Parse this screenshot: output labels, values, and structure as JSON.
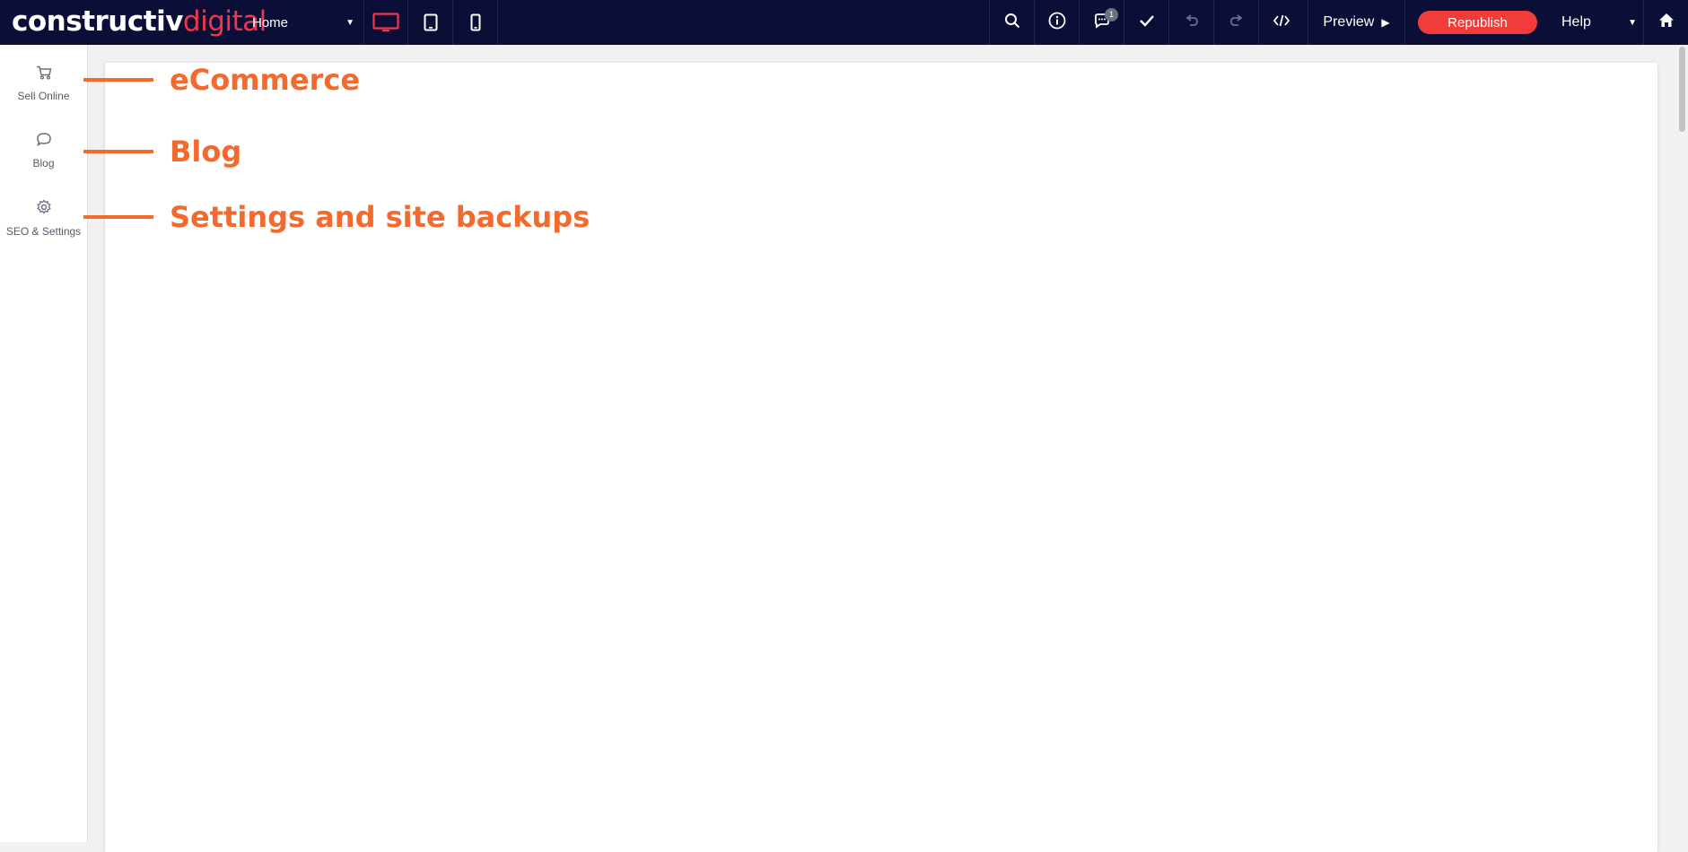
{
  "header": {
    "logo_part1": "constructiv",
    "logo_part2": "digital",
    "page_selector": "Home",
    "device_buttons": [
      {
        "name": "desktop",
        "icon": "desktop-icon",
        "active": true
      },
      {
        "name": "tablet",
        "icon": "tablet-icon",
        "active": false
      },
      {
        "name": "mobile",
        "icon": "mobile-icon",
        "active": false
      }
    ],
    "tools": [
      {
        "name": "search",
        "icon": "search-icon"
      },
      {
        "name": "info",
        "icon": "info-icon"
      },
      {
        "name": "comments",
        "icon": "comment-icon",
        "badge": "1"
      },
      {
        "name": "check",
        "icon": "checkmark-icon"
      },
      {
        "name": "undo",
        "icon": "undo-icon"
      },
      {
        "name": "redo",
        "icon": "redo-icon"
      },
      {
        "name": "code",
        "icon": "code-icon"
      }
    ],
    "preview_label": "Preview",
    "republish_label": "Republish",
    "help_label": "Help",
    "home_icon": "home-icon"
  },
  "sidebar": {
    "items": [
      {
        "label": "Sell Online",
        "icon": "cart-icon"
      },
      {
        "label": "Blog",
        "icon": "chat-bubble-icon"
      },
      {
        "label": "SEO & Settings",
        "icon": "gear-icon"
      }
    ]
  },
  "annotations": [
    {
      "text": "eCommerce"
    },
    {
      "text": "Blog"
    },
    {
      "text": "Settings and site backups"
    }
  ],
  "colors": {
    "topbar_bg": "#0b0f38",
    "accent_red": "#f23b3b",
    "annotation_orange": "#f26a2e",
    "active_device": "#f2364a"
  }
}
